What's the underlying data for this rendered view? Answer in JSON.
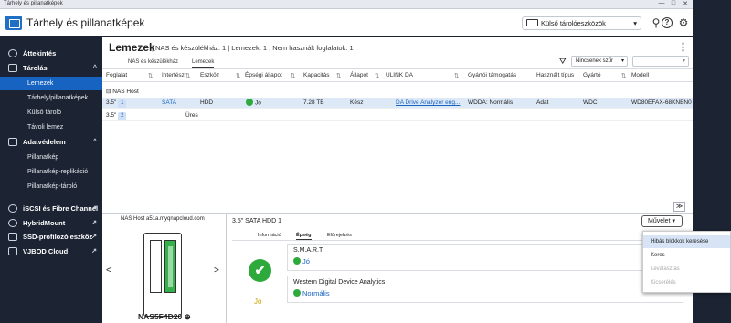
{
  "window": {
    "title": "Tárhely és pillanatképek",
    "min": "—",
    "max": "□",
    "close": "✕"
  },
  "header": {
    "app_title": "Tárhely és pillanatképek",
    "external_storage": "Külső tárolóeszközök",
    "chevron": "▾",
    "search": "🔍",
    "help": "?",
    "settings": "⚙"
  },
  "sidebar": {
    "overview": "Áttekintés",
    "storage": "Tárolás",
    "storage_items": [
      "Lemezek",
      "Tárhely/pillanatképek",
      "Külső tároló",
      "Távoli lemez"
    ],
    "protection": "Adatvédelem",
    "protection_items": [
      "Pillanatkép",
      "Pillanatkép-replikáció",
      "Pillanatkép-tároló"
    ],
    "links": [
      "iSCSI és Fibre Channel",
      "HybridMount",
      "SSD-profilozó eszköz",
      "VJBOD Cloud"
    ],
    "collapse": "^",
    "external": "↗"
  },
  "main": {
    "title": "Lemezek",
    "subtitle": "| NAS és készülékház: 1 | Lemezek: 1 , Nem használt foglalatok: 1",
    "more": "⋮",
    "tabs": [
      "NAS és készülékház",
      "Lemezek"
    ],
    "filter": "Nincsenek szűr",
    "filter_chev": "▾",
    "search_chev": "▾",
    "columns": [
      "Foglalat",
      "Interfész",
      "Eszköz",
      "Épségi állapot",
      "Kapacitás",
      "Állapot",
      "ULINK DA",
      "Gyártói támogatás",
      "Használt típus",
      "Gyártó",
      "Modell"
    ],
    "sort": "⇅",
    "group": "NAS Host",
    "group_toggle": "⊟",
    "rows": [
      {
        "slot": "3.5\"",
        "slot_num": "1",
        "iface": "SATA",
        "device": "HDD",
        "health": "Jó",
        "capacity": "7.28 TB",
        "status": "Kész",
        "ulink": "DA Drive Analyzer eng...",
        "vendor_support": "WDDA: Normális",
        "type": "Adat",
        "maker": "WDC",
        "model": "WD80EFAX-68KNBN0"
      },
      {
        "slot": "3.5\"",
        "slot_num": "2",
        "device": "Üres"
      }
    ],
    "expand": "≫"
  },
  "details": {
    "nas_label": "NAS Host a51a.myqnapcloud.com",
    "nas_name": "NAS5F4D20",
    "zoom": "⊕",
    "prev": "<",
    "next": ">",
    "title": "3.5\" SATA HDD 1",
    "action": "Művelet",
    "action_chev": "▾",
    "tabs": [
      "Információ",
      "Épség",
      "Előrejelzés"
    ],
    "overall": "Jó",
    "check": "✔",
    "smart_title": "S.M.A.R.T",
    "smart_value": "Jó",
    "wdda_title": "Western Digital Device Analytics",
    "wdda_value": "Normális"
  },
  "menu": {
    "items": [
      "Hibás blokkok keresése",
      "Keres",
      "Leválasztás",
      "Kicserélés"
    ]
  },
  "colors": {
    "accent": "#1763c2",
    "ok": "#2eaa3c",
    "sidebar": "#1c2433"
  }
}
